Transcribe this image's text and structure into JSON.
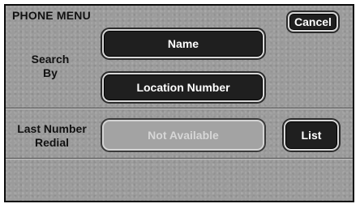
{
  "header": {
    "title": "PHONE MENU",
    "cancel_label": "Cancel"
  },
  "search": {
    "label": "Search By",
    "name_label": "Name",
    "location_label": "Location Number"
  },
  "redial": {
    "label": "Last Number Redial",
    "value": "Not Available",
    "list_label": "List"
  },
  "colors": {
    "background": "#9b9b9b",
    "button_dark": "#1f1f1f",
    "button_disabled": "#a3a3a3"
  }
}
